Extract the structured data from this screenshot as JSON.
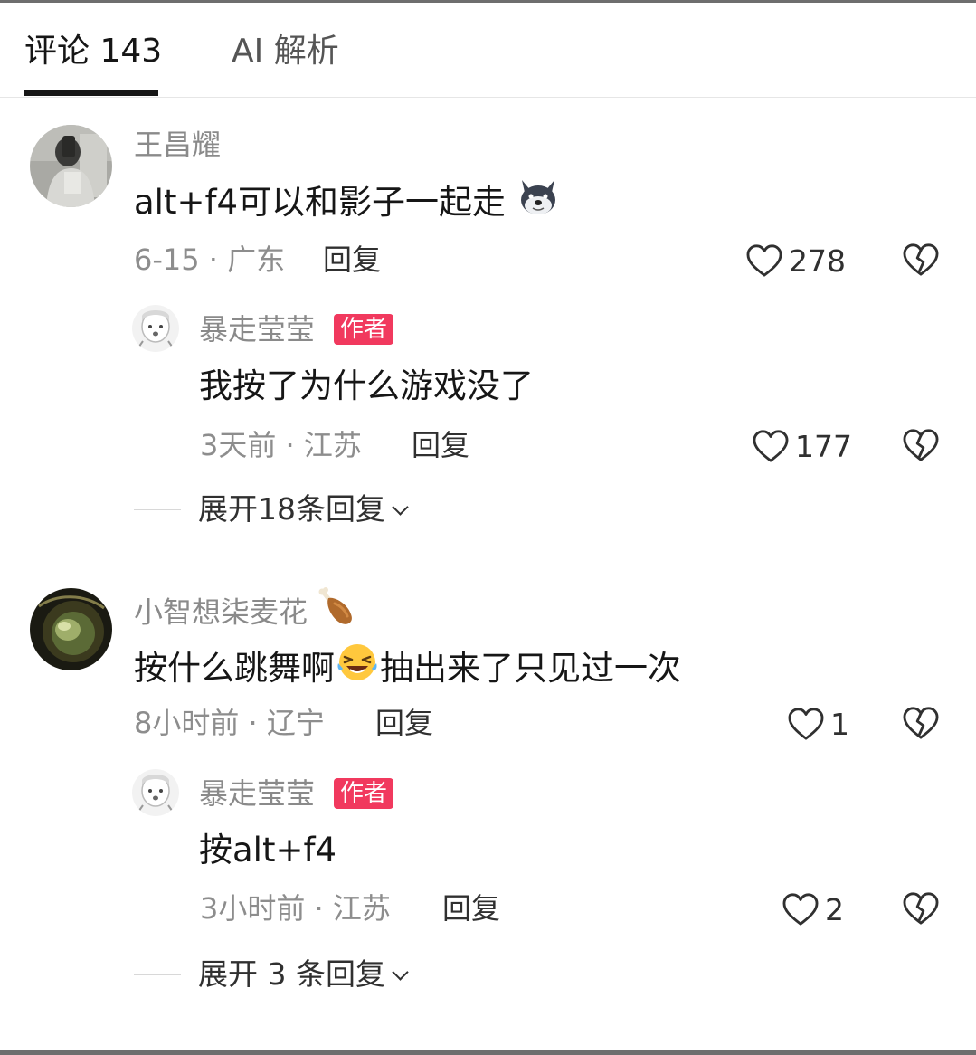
{
  "tabs": [
    {
      "label": "评论 143",
      "active": true
    },
    {
      "label": "AI 解析",
      "active": false
    }
  ],
  "author_badge": "作者",
  "comments": [
    {
      "username": "王昌耀",
      "text": "alt+f4可以和影子一起走",
      "emoji": "dog-face-emoji",
      "meta": "6-15 · 广东",
      "reply_label": "回复",
      "likes": "278",
      "reply": {
        "username": "暴走莹莹",
        "text": "我按了为什么游戏没了",
        "meta": "3天前 · 江苏",
        "reply_label": "回复",
        "likes": "177"
      },
      "expand_label": "展开18条回复"
    },
    {
      "username": "小智想柒麦花",
      "name_emoji": "drumstick-emoji",
      "text_before": "按什么跳舞啊",
      "emoji": "rolling-laughing-emoji",
      "text_after": "抽出来了只见过一次",
      "meta": "8小时前 · 辽宁",
      "reply_label": "回复",
      "likes": "1",
      "reply": {
        "username": "暴走莹莹",
        "text": "按alt+f4",
        "meta": "3小时前 · 江苏",
        "reply_label": "回复",
        "likes": "2"
      },
      "expand_label": "展开 3 条回复"
    }
  ],
  "colors": {
    "badge": "#f1395e",
    "text": "#161616",
    "muted": "#8a8a8a"
  }
}
